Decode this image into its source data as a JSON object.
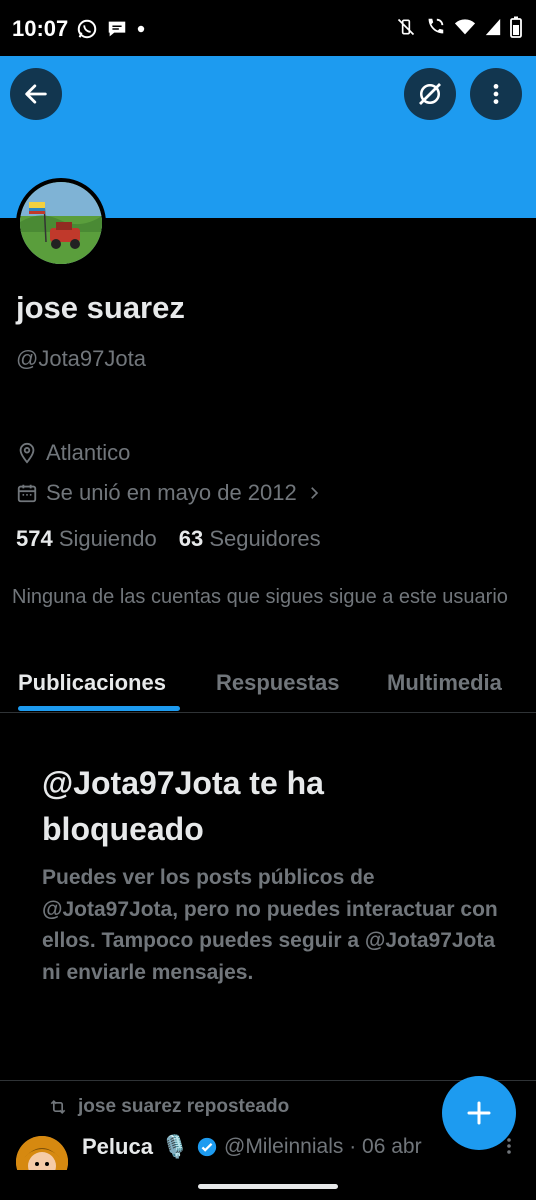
{
  "status_bar": {
    "time": "10:07",
    "left_icons": [
      "whatsapp-icon",
      "chat-bubble-icon",
      "dot-icon"
    ],
    "right_icons": [
      "vibrate-off-icon",
      "call-wifi-icon",
      "wifi-icon",
      "signal-icon",
      "battery-icon"
    ]
  },
  "header": {
    "back_icon": "arrow-left-icon",
    "grok_icon": "grok-icon",
    "more_icon": "more-vertical-icon",
    "banner_color": "#1d9bf0"
  },
  "profile": {
    "name": "jose suarez",
    "handle": "@Jota97Jota",
    "location": "Atlantico",
    "joined": "Se unió en mayo de 2012",
    "following_count": "574",
    "following_label": "Siguiendo",
    "followers_count": "63",
    "followers_label": "Seguidores",
    "mutuals_note": "Ninguna de las cuentas que sigues sigue a este usuario"
  },
  "tabs": [
    {
      "label": "Publicaciones",
      "active": true
    },
    {
      "label": "Respuestas",
      "active": false
    },
    {
      "label": "Multimedia",
      "active": false
    }
  ],
  "blocked": {
    "title": "@Jota97Jota te ha bloqueado",
    "body": "Puedes ver los posts públicos de @Jota97Jota, pero no puedes interactuar con ellos. Tampoco puedes seguir a @Jota97Jota ni enviarle mensajes."
  },
  "feed": {
    "repost_label": "jose suarez reposteado",
    "tweet": {
      "author": "Peluca",
      "emoji": "🎙️",
      "handle_date": "@Mileinnials · 06 abr",
      "verified": true
    }
  },
  "fab": {
    "icon": "plus-icon"
  },
  "colors": {
    "accent": "#1d9bf0",
    "muted": "#71767b",
    "text": "#e7e9ea",
    "background": "#000000"
  }
}
